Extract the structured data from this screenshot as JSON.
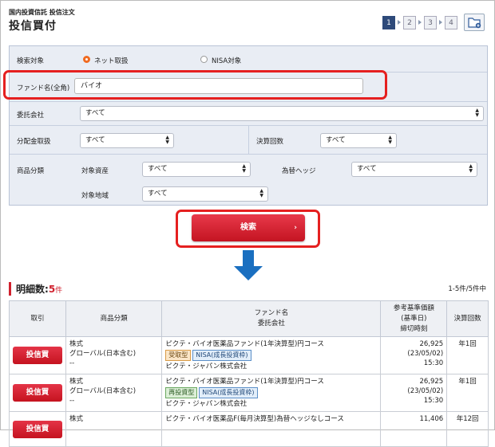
{
  "header": {
    "breadcrumb": "国内投資信託 投信注文",
    "title": "投信買付",
    "steps": [
      "1",
      "2",
      "3",
      "4"
    ],
    "active_step": "1"
  },
  "form": {
    "search_target": {
      "label": "検索対象",
      "options": [
        "ネット取扱",
        "NISA対象"
      ],
      "selected": "ネット取扱"
    },
    "fund_name": {
      "label": "ファンド名(全角)",
      "value": "バイオ"
    },
    "management_company": {
      "label": "委託会社",
      "value": "すべて"
    },
    "distribution": {
      "label": "分配金取扱",
      "value": "すべて"
    },
    "settlement_count": {
      "label": "決算回数",
      "value": "すべて"
    },
    "product_category": {
      "label": "商品分類",
      "asset_label": "対象資産",
      "asset_value": "すべて",
      "hedge_label": "為替ヘッジ",
      "hedge_value": "すべて",
      "region_label": "対象地域",
      "region_value": "すべて"
    },
    "search_button": "検索"
  },
  "results": {
    "count_label": "明細数:",
    "count": "5",
    "count_unit": "件",
    "range": "1-5件/5件中",
    "headers": {
      "action": "取引",
      "category": "商品分類",
      "fund_line1": "ファンド名",
      "fund_line2": "委託会社",
      "price_line1": "参考基準価額",
      "price_line2": "(基準日)",
      "price_line3": "締切時刻",
      "settlement": "決算回数"
    },
    "rows": [
      {
        "button": "投信買",
        "cat1": "株式",
        "cat2": "グローバル(日本含む)",
        "cat3": "--",
        "fund": "ピクテ・バイオ医薬品ファンド(1年決算型)円コース",
        "badge1": "受取型",
        "badge2": "NISA(成長投資枠)",
        "company": "ピクテ・ジャパン株式会社",
        "price": "26,925",
        "date": "(23/05/02)",
        "cutoff": "15:30",
        "settlement": "年1回"
      },
      {
        "button": "投信買",
        "cat1": "株式",
        "cat2": "グローバル(日本含む)",
        "cat3": "--",
        "fund": "ピクテ・バイオ医薬品ファンド(1年決算型)円コース",
        "badge1": "再投資型",
        "badge2": "NISA(成長投資枠)",
        "company": "ピクテ・ジャパン株式会社",
        "price": "26,925",
        "date": "(23/05/02)",
        "cutoff": "15:30",
        "settlement": "年1回"
      },
      {
        "button": "投信買",
        "cat1": "株式",
        "fund": "ピクテ・バイオ医薬品F(毎月決算型)為替ヘッジなしコース",
        "price": "11,406",
        "settlement": "年12回"
      }
    ]
  },
  "colors": {
    "accent_red": "#d0212e",
    "step_active": "#2e4a7a",
    "arrow_blue": "#1a6fc0"
  }
}
